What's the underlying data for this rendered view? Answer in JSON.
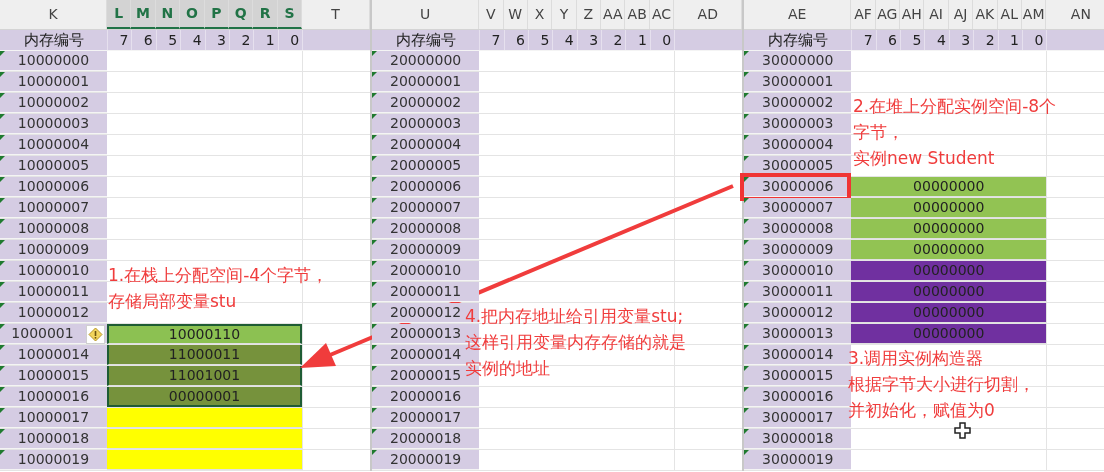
{
  "panels": [
    {
      "columns": [
        {
          "letter": "K",
          "selected": false
        },
        {
          "letter": "L",
          "selected": true
        },
        {
          "letter": "M",
          "selected": true
        },
        {
          "letter": "N",
          "selected": true
        },
        {
          "letter": "O",
          "selected": true
        },
        {
          "letter": "P",
          "selected": true
        },
        {
          "letter": "Q",
          "selected": true
        },
        {
          "letter": "R",
          "selected": true
        },
        {
          "letter": "S",
          "selected": true
        },
        {
          "letter": "T",
          "selected": false
        }
      ],
      "header": {
        "label": "内存编号",
        "bits": [
          "7",
          "6",
          "5",
          "4",
          "3",
          "2",
          "1",
          "0"
        ]
      },
      "rows": [
        {
          "address": "10000000",
          "selected": false,
          "warning": false,
          "boxed": false
        },
        {
          "address": "10000001",
          "selected": false,
          "warning": false,
          "boxed": false
        },
        {
          "address": "10000002",
          "selected": false,
          "warning": false,
          "boxed": false
        },
        {
          "address": "10000003",
          "selected": false,
          "warning": false,
          "boxed": false
        },
        {
          "address": "10000004",
          "selected": false,
          "warning": false,
          "boxed": false
        },
        {
          "address": "10000005",
          "selected": false,
          "warning": false,
          "boxed": false
        },
        {
          "address": "10000006",
          "selected": false,
          "warning": false,
          "boxed": false
        },
        {
          "address": "10000007",
          "selected": false,
          "warning": false,
          "boxed": false
        },
        {
          "address": "10000008",
          "selected": false,
          "warning": false,
          "boxed": false
        },
        {
          "address": "10000009",
          "selected": false,
          "warning": false,
          "boxed": false
        },
        {
          "address": "10000010",
          "selected": false,
          "warning": false,
          "boxed": false
        },
        {
          "address": "10000011",
          "selected": false,
          "warning": false,
          "boxed": false
        },
        {
          "address": "10000012",
          "selected": false,
          "warning": false,
          "boxed": false
        },
        {
          "address": "1000001",
          "value": "10000110",
          "color": "#8cc152",
          "selected": true,
          "warning": true,
          "boxed": false
        },
        {
          "address": "10000014",
          "value": "11000011",
          "color": "#76923c",
          "selected": true,
          "warning": false,
          "boxed": false
        },
        {
          "address": "10000015",
          "value": "11001001",
          "color": "#76923c",
          "selected": true,
          "warning": false,
          "boxed": false
        },
        {
          "address": "10000016",
          "value": "00000001",
          "color": "#76923c",
          "selected": true,
          "warning": false,
          "boxed": false
        },
        {
          "address": "10000017",
          "color": "#ffff00",
          "selected": false,
          "warning": false,
          "boxed": false
        },
        {
          "address": "10000018",
          "color": "#ffff00",
          "selected": false,
          "warning": false,
          "boxed": false
        },
        {
          "address": "10000019",
          "color": "#ffff00",
          "selected": false,
          "warning": false,
          "boxed": false
        }
      ]
    },
    {
      "columns": [
        {
          "letter": "U",
          "selected": false
        },
        {
          "letter": "V",
          "selected": false
        },
        {
          "letter": "W",
          "selected": false
        },
        {
          "letter": "X",
          "selected": false
        },
        {
          "letter": "Y",
          "selected": false
        },
        {
          "letter": "Z",
          "selected": false
        },
        {
          "letter": "AA",
          "selected": false
        },
        {
          "letter": "AB",
          "selected": false
        },
        {
          "letter": "AC",
          "selected": false
        },
        {
          "letter": "AD",
          "selected": false
        }
      ],
      "header": {
        "label": "内存编号",
        "bits": [
          "7",
          "6",
          "5",
          "4",
          "3",
          "2",
          "1",
          "0"
        ]
      },
      "rows": [
        {
          "address": "20000000",
          "selected": false,
          "warning": false,
          "boxed": false
        },
        {
          "address": "20000001",
          "selected": false,
          "warning": false,
          "boxed": false
        },
        {
          "address": "20000002",
          "selected": false,
          "warning": false,
          "boxed": false
        },
        {
          "address": "20000003",
          "selected": false,
          "warning": false,
          "boxed": false
        },
        {
          "address": "20000004",
          "selected": false,
          "warning": false,
          "boxed": false
        },
        {
          "address": "20000005",
          "selected": false,
          "warning": false,
          "boxed": false
        },
        {
          "address": "20000006",
          "selected": false,
          "warning": false,
          "boxed": false
        },
        {
          "address": "20000007",
          "selected": false,
          "warning": false,
          "boxed": false
        },
        {
          "address": "20000008",
          "selected": false,
          "warning": false,
          "boxed": false
        },
        {
          "address": "20000009",
          "selected": false,
          "warning": false,
          "boxed": false
        },
        {
          "address": "20000010",
          "selected": false,
          "warning": false,
          "boxed": false
        },
        {
          "address": "20000011",
          "selected": false,
          "warning": false,
          "boxed": false
        },
        {
          "address": "20000012",
          "selected": false,
          "warning": false,
          "boxed": false
        },
        {
          "address": "20000013",
          "selected": false,
          "warning": false,
          "boxed": false
        },
        {
          "address": "20000014",
          "selected": false,
          "warning": false,
          "boxed": false
        },
        {
          "address": "20000015",
          "selected": false,
          "warning": false,
          "boxed": false
        },
        {
          "address": "20000016",
          "selected": false,
          "warning": false,
          "boxed": false
        },
        {
          "address": "20000017",
          "selected": false,
          "warning": false,
          "boxed": false
        },
        {
          "address": "20000018",
          "selected": false,
          "warning": false,
          "boxed": false
        },
        {
          "address": "20000019",
          "selected": false,
          "warning": false,
          "boxed": false
        }
      ]
    },
    {
      "columns": [
        {
          "letter": "AE",
          "selected": false
        },
        {
          "letter": "AF",
          "selected": false
        },
        {
          "letter": "AG",
          "selected": false
        },
        {
          "letter": "AH",
          "selected": false
        },
        {
          "letter": "AI",
          "selected": false
        },
        {
          "letter": "AJ",
          "selected": false
        },
        {
          "letter": "AK",
          "selected": false
        },
        {
          "letter": "AL",
          "selected": false
        },
        {
          "letter": "AM",
          "selected": false
        },
        {
          "letter": "AN",
          "selected": false
        }
      ],
      "header": {
        "label": "内存编号",
        "bits": [
          "7",
          "6",
          "5",
          "4",
          "3",
          "2",
          "1",
          "0"
        ]
      },
      "rows": [
        {
          "address": "30000000",
          "selected": false,
          "warning": false,
          "boxed": false
        },
        {
          "address": "30000001",
          "selected": false,
          "warning": false,
          "boxed": false
        },
        {
          "address": "30000002",
          "selected": false,
          "warning": false,
          "boxed": false
        },
        {
          "address": "30000003",
          "selected": false,
          "warning": false,
          "boxed": false
        },
        {
          "address": "30000004",
          "selected": false,
          "warning": false,
          "boxed": false
        },
        {
          "address": "30000005",
          "selected": false,
          "warning": false,
          "boxed": false
        },
        {
          "address": "30000006",
          "value": "00000000",
          "color": "#92c353",
          "selected": false,
          "warning": false,
          "boxed": true
        },
        {
          "address": "30000007",
          "value": "00000000",
          "color": "#92c353",
          "selected": false,
          "warning": false,
          "boxed": false
        },
        {
          "address": "30000008",
          "value": "00000000",
          "color": "#92c353",
          "selected": false,
          "warning": false,
          "boxed": false
        },
        {
          "address": "30000009",
          "value": "00000000",
          "color": "#92c353",
          "selected": false,
          "warning": false,
          "boxed": false
        },
        {
          "address": "30000010",
          "value": "00000000",
          "color": "#7030a0",
          "selected": false,
          "warning": false,
          "boxed": false
        },
        {
          "address": "30000011",
          "value": "00000000",
          "color": "#7030a0",
          "selected": false,
          "warning": false,
          "boxed": false
        },
        {
          "address": "30000012",
          "value": "00000000",
          "color": "#7030a0",
          "selected": false,
          "warning": false,
          "boxed": false
        },
        {
          "address": "30000013",
          "value": "00000000",
          "color": "#7030a0",
          "selected": false,
          "warning": false,
          "boxed": false
        },
        {
          "address": "30000014",
          "selected": false,
          "warning": false,
          "boxed": false
        },
        {
          "address": "30000015",
          "selected": false,
          "warning": false,
          "boxed": false
        },
        {
          "address": "30000016",
          "selected": false,
          "warning": false,
          "boxed": false
        },
        {
          "address": "30000017",
          "selected": false,
          "warning": false,
          "boxed": false
        },
        {
          "address": "30000018",
          "selected": false,
          "warning": false,
          "boxed": false
        },
        {
          "address": "30000019",
          "selected": false,
          "warning": false,
          "boxed": false
        }
      ]
    }
  ],
  "annotations": [
    {
      "lines": [
        "1.在栈上分配空间-4个字节，",
        "存储局部变量stu"
      ]
    },
    {
      "lines": [
        "2.在堆上分配实例空间-8个",
        "字节，",
        "实例new Student"
      ]
    },
    {
      "lines": [
        "3.调用实例构造器",
        "根据字节大小进行切割，",
        "并初始化，赋值为0"
      ]
    },
    {
      "lines": [
        "4.把内存地址给引用变量stu;",
        "这样引用变量内存存储的就是",
        "实例的地址"
      ]
    }
  ]
}
